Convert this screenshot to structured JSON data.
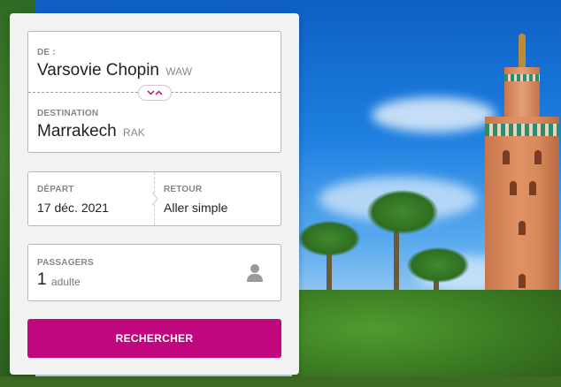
{
  "route": {
    "origin_label": "DE :",
    "origin_city": "Varsovie Chopin",
    "origin_code": "WAW",
    "destination_label": "DESTINATION",
    "destination_city": "Marrakech",
    "destination_code": "RAK",
    "swap_icon": "swap-arrows-icon"
  },
  "dates": {
    "departure_label": "DÉPART",
    "departure_value": "17 déc. 2021",
    "return_label": "RETOUR",
    "return_value": "Aller simple"
  },
  "passengers": {
    "label": "PASSAGERS",
    "count": "1",
    "unit": "adulte",
    "icon": "person-icon"
  },
  "search_button": {
    "label": "RECHERCHER"
  },
  "colors": {
    "accent": "#c1077d",
    "card_bg": "#f2f2f2",
    "field_border": "#b9b9b9",
    "label_gray": "#858585"
  }
}
